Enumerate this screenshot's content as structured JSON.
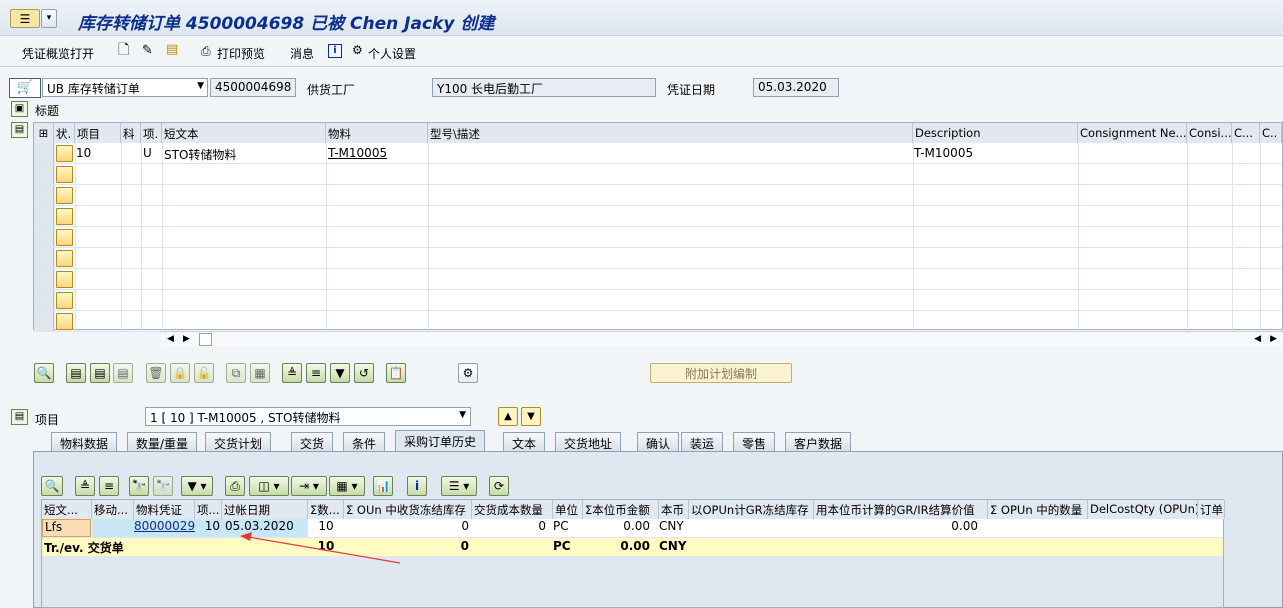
{
  "title": "库存转储订单 4500004698 已被 Chen Jacky 创建",
  "toolbar": {
    "overview": "凭证概览打开",
    "print_preview": "打印预览",
    "messages": "消息",
    "personal_settings": "个人设置"
  },
  "header": {
    "doc_type": "UB 库存转储订单",
    "doc_number": "4500004698",
    "supplying_plant_label": "供货工厂",
    "supplying_plant_value": "Y100 长电后勤工厂",
    "doc_date_label": "凭证日期",
    "doc_date_value": "05.03.2020",
    "header_label": "标题"
  },
  "item_overview": {
    "columns": [
      "状.",
      "项目",
      "科",
      "项.",
      "短文本",
      "物料",
      "型号\\描述",
      "Description",
      "Consignment Ne...",
      "Consi...",
      "C...",
      "C.."
    ],
    "rows": [
      {
        "item": "10",
        "a": "",
        "i": "U",
        "short_text": "STO转储物料",
        "material": "T-M10005",
        "desc": "",
        "description": "T-M10005"
      }
    ]
  },
  "additional_planning_button": "附加计划编制",
  "item_detail": {
    "label": "项目",
    "selected_item": "1 [ 10 ] T-M10005 , STO转储物料",
    "tabs": [
      "物料数据",
      "数量/重量",
      "交货计划",
      "交货",
      "条件",
      "采购订单历史",
      "文本",
      "交货地址",
      "确认",
      "装运",
      "零售",
      "客户数据"
    ],
    "active_tab": "采购订单历史"
  },
  "history": {
    "columns": [
      "短文...",
      "移动...",
      "物料凭证",
      "项...",
      "过帐日期",
      "Σ数...",
      "Σ OUn 中收货冻结库存",
      "交货成本数量",
      "单位",
      "Σ本位币金额",
      "本币",
      "以OPUn计GR冻结库存",
      "用本位币计算的GR/IR结算价值",
      "Σ OPUn 中的数量",
      "DelCostQty (OPUn)",
      "订单"
    ],
    "row": {
      "short": "Lfs",
      "move": "",
      "matdoc": "80000029",
      "item": "10",
      "date": "05.03.2020",
      "qty": "10",
      "blocked": "0",
      "delcost": "0",
      "unit": "PC",
      "amount": "0.00",
      "currency": "CNY",
      "grir": "0.00"
    },
    "total": {
      "label": "Tr./ev. 交货单",
      "qty": "10",
      "blocked": "0",
      "unit": "PC",
      "amount": "0.00",
      "currency": "CNY"
    }
  },
  "colors": {
    "accent_blue": "#0b2f8f",
    "total_row": "#fffbc2",
    "link_blue": "#c7e6f6",
    "arrow": "#e53935"
  }
}
